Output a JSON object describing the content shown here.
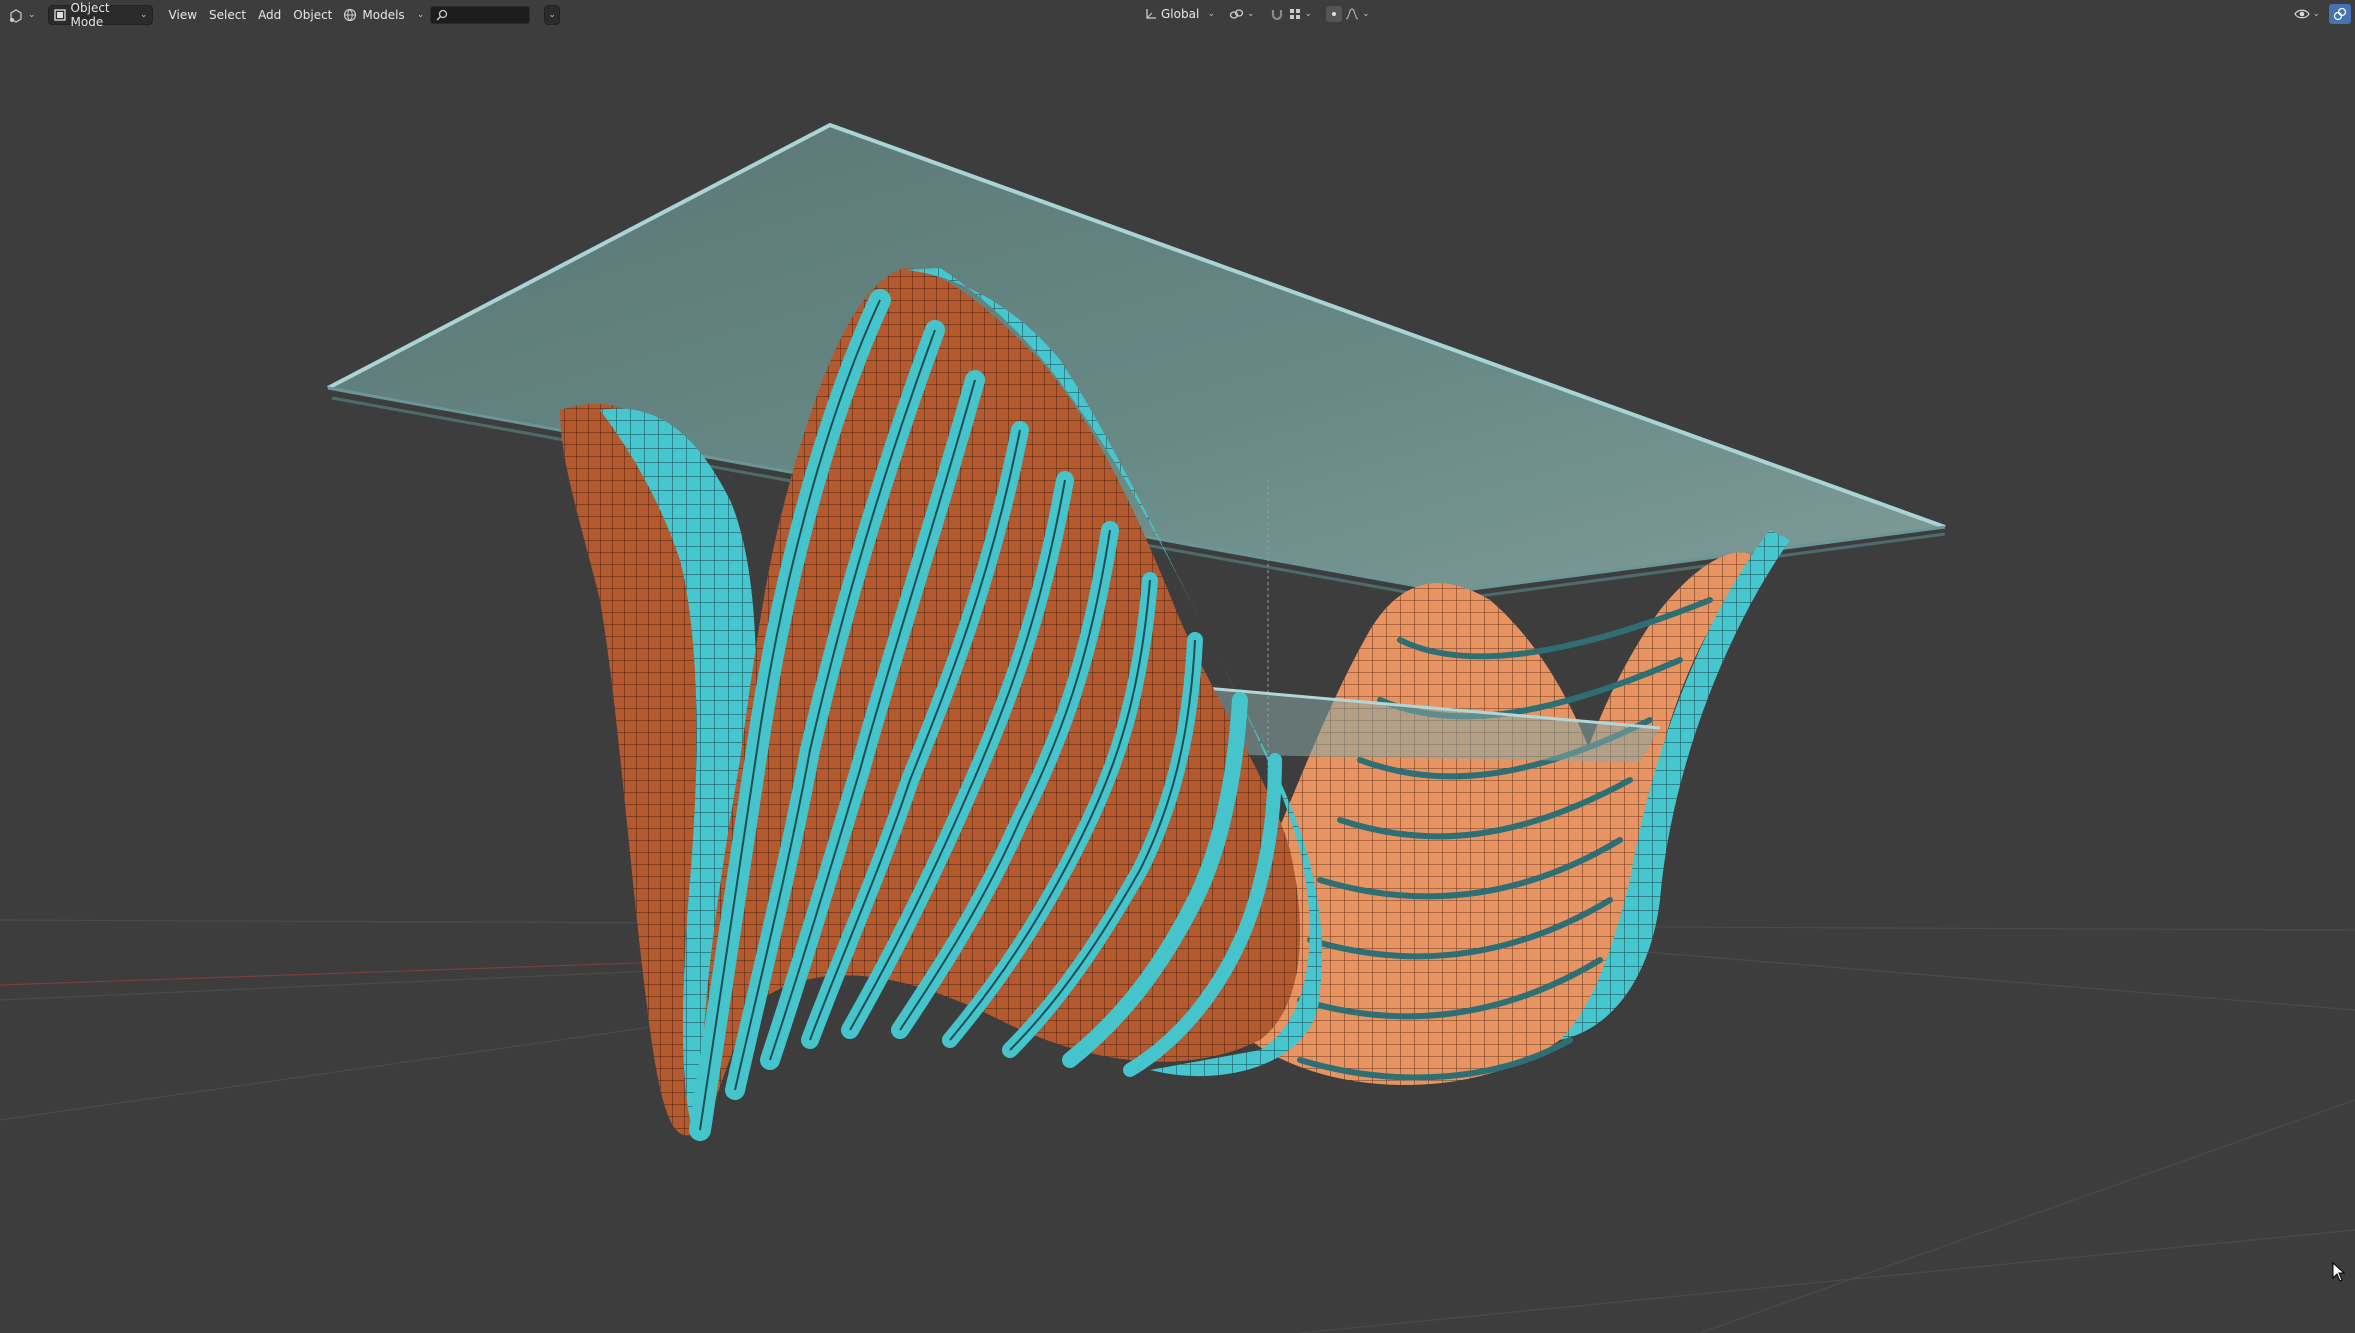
{
  "header": {
    "mode_label": "Object Mode",
    "menus": [
      "View",
      "Select",
      "Add",
      "Object"
    ],
    "collection_label": "Models",
    "search_value": ""
  },
  "transform": {
    "orientation_label": "Global"
  },
  "icons": {
    "editor_type": "3d-viewport-icon",
    "orientation": "orientation-axes-icon",
    "pivot": "link-chain-icon",
    "snap": "magnet-icon",
    "snap_grid": "grid-snap-icon",
    "proportional": "proportional-edit-icon",
    "falloff": "falloff-curve-icon",
    "gizmo": "eye-gizmo-icon",
    "overlay": "overlay-icon"
  },
  "colors": {
    "viewport_bg": "#3d3d3d",
    "teal": "#3cc6cc",
    "orange": "#e08a55",
    "glass": "#7ab0b0"
  }
}
